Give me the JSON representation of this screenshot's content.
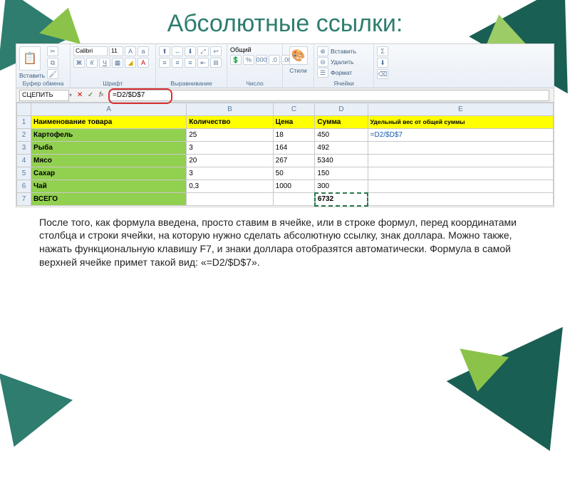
{
  "title": "Абсолютные ссылки:",
  "ribbon": {
    "paste": "Вставить",
    "clipboard_label": "Буфер обмена",
    "font_name": "Calibri",
    "font_size": "11",
    "font_label": "Шрифт",
    "align_label": "Выравнивание",
    "number_format": "Общий",
    "number_label": "Число",
    "styles": "Стили",
    "insert": "Вставить",
    "delete": "Удалить",
    "format": "Формат",
    "cells_label": "Ячейки"
  },
  "formula_bar": {
    "name_box": "СЦЕПИТЬ",
    "formula": "=D2/$D$7"
  },
  "columns": [
    "A",
    "B",
    "C",
    "D",
    "E"
  ],
  "headers": {
    "name": "Наименование товара",
    "qty": "Количество",
    "price": "Цена",
    "sum": "Сумма",
    "weight": "Удельный вес от общей суммы"
  },
  "rows": [
    {
      "n": "2",
      "name": "Картофель",
      "qty": "25",
      "price": "18",
      "sum": "450",
      "e": "=D2/$D$7"
    },
    {
      "n": "3",
      "name": "Рыба",
      "qty": "3",
      "price": "164",
      "sum": "492",
      "e": ""
    },
    {
      "n": "4",
      "name": "Мясо",
      "qty": "20",
      "price": "267",
      "sum": "5340",
      "e": ""
    },
    {
      "n": "5",
      "name": "Сахар",
      "qty": "3",
      "price": "50",
      "sum": "150",
      "e": ""
    },
    {
      "n": "6",
      "name": "Чай",
      "qty": "0,3",
      "price": "1000",
      "sum": "300",
      "e": ""
    }
  ],
  "total_row": {
    "n": "7",
    "name": "ВСЕГО",
    "sum": "6732"
  },
  "body_text": "После того, как формула введена, просто ставим в ячейке, или в строке формул, перед координатами столбца и строки ячейки, на которую нужно сделать абсолютную ссылку, знак доллара. Можно также,  нажать функциональную клавишу F7, и знаки доллара отобразятся автоматически. Формула в самой верхней ячейке примет такой вид: «=D2/$D$7»."
}
